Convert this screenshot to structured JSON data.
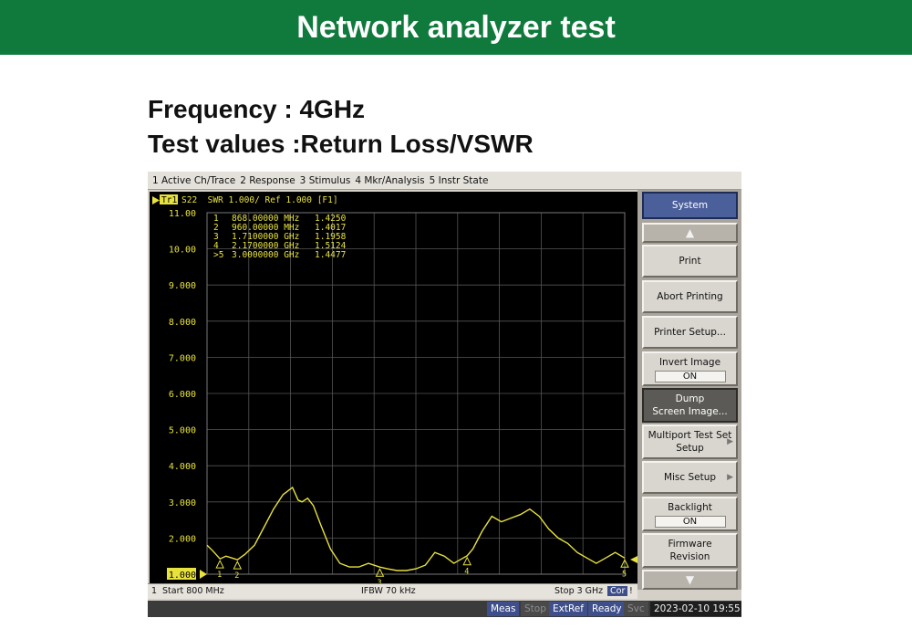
{
  "banner": {
    "title": "Network analyzer test"
  },
  "info": {
    "frequency": "Frequency : 4GHz",
    "test_values": "Test values :Return Loss/VSWR"
  },
  "menu": [
    "1 Active Ch/Trace",
    "2 Response",
    "3 Stimulus",
    "4 Mkr/Analysis",
    "5 Instr State"
  ],
  "trace_header": {
    "tag": "Tr1",
    "text": "S22  SWR 1.000/ Ref 1.000 [F1]"
  },
  "markers": [
    {
      "num": "1",
      "freq": "868.00000 MHz",
      "value": "1.4250"
    },
    {
      "num": "2",
      "freq": "960.00000 MHz",
      "value": "1.4017"
    },
    {
      "num": "3",
      "freq": "1.7100000 GHz",
      "value": "1.1958"
    },
    {
      "num": "4",
      "freq": "2.1700000 GHz",
      "value": "1.5124"
    },
    {
      "num": ">5",
      "freq": "3.0000000 GHz",
      "value": "1.4477"
    }
  ],
  "chart_data": {
    "type": "line",
    "title": "",
    "xlabel": "",
    "ylabel": "",
    "xlim_ghz": [
      0.8,
      3.0
    ],
    "ylim": [
      1.0,
      11.0
    ],
    "y_ticks": [
      "11.00",
      "10.00",
      "9.000",
      "8.000",
      "7.000",
      "6.000",
      "5.000",
      "4.000",
      "3.000",
      "2.000",
      "1.000"
    ],
    "grid": true,
    "trace_color": "#e8e23c",
    "series": [
      {
        "x_ghz": [
          0.8,
          0.83,
          0.868,
          0.9,
          0.93,
          0.96,
          1.0,
          1.05,
          1.1,
          1.15,
          1.2,
          1.25,
          1.28,
          1.3,
          1.33,
          1.36,
          1.4,
          1.45,
          1.5,
          1.55,
          1.6,
          1.65,
          1.71,
          1.75,
          1.8,
          1.85,
          1.9,
          1.95,
          2.0,
          2.05,
          2.1,
          2.17,
          2.2,
          2.25,
          2.3,
          2.35,
          2.4,
          2.45,
          2.5,
          2.55,
          2.6,
          2.65,
          2.7,
          2.75,
          2.8,
          2.85,
          2.9,
          2.95,
          3.0
        ],
        "swr": [
          1.8,
          1.65,
          1.425,
          1.5,
          1.45,
          1.4,
          1.55,
          1.8,
          2.3,
          2.8,
          3.2,
          3.4,
          3.05,
          3.0,
          3.1,
          2.9,
          2.35,
          1.7,
          1.3,
          1.2,
          1.2,
          1.3,
          1.196,
          1.15,
          1.1,
          1.1,
          1.15,
          1.25,
          1.6,
          1.5,
          1.3,
          1.51,
          1.7,
          2.2,
          2.6,
          2.45,
          2.55,
          2.65,
          2.8,
          2.6,
          2.25,
          2.0,
          1.85,
          1.6,
          1.45,
          1.3,
          1.45,
          1.6,
          1.448
        ]
      }
    ]
  },
  "softkeys": {
    "title": "System",
    "print": "Print",
    "abort": "Abort Printing",
    "printer_setup": "Printer Setup...",
    "invert_label": "Invert Image",
    "invert_value": "ON",
    "dump_line1": "Dump",
    "dump_line2": "Screen Image...",
    "multiport_line1": "Multiport Test Set",
    "multiport_line2": "Setup",
    "misc": "Misc Setup",
    "backlight_label": "Backlight",
    "backlight_value": "ON",
    "firmware_line1": "Firmware",
    "firmware_line2": "Revision"
  },
  "status": {
    "channel": "1",
    "start": "Start 800 MHz",
    "ifbw": "IFBW 70 kHz",
    "stop": "Stop 3 GHz",
    "cor": "Cor",
    "excl": "!"
  },
  "bottom": {
    "meas": "Meas",
    "stop": "Stop",
    "extref": "ExtRef",
    "ready": "Ready",
    "svc": "Svc",
    "datetime": "2023-02-10 19:55"
  }
}
